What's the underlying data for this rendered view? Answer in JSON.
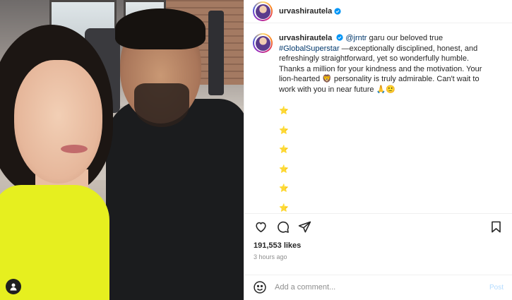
{
  "photo": {
    "user_tag_icon": "person-icon"
  },
  "header": {
    "username": "urvashirautela",
    "verified_icon": "verified-badge-icon",
    "more_icon": "more-horizontal-icon"
  },
  "caption": {
    "username": "urvashirautela",
    "mention": "@jrntr",
    "text_part1": " garu our beloved true ",
    "hashtag": "#GlobalSuperstar",
    "text_part2": " —exceptionally disciplined, honest, and refreshingly straightforward, yet so wonderfully humble. Thanks a million for your kindness and the motivation. Your lion-hearted 🦁 personality is truly admirable. Can't wait to work with you in near future 🙏🙂",
    "stars": [
      "⭐",
      "⭐",
      "⭐",
      "⭐",
      "⭐",
      "⭐"
    ]
  },
  "actions": {
    "like_icon": "heart-icon",
    "comment_icon": "comment-icon",
    "share_icon": "share-icon",
    "save_icon": "bookmark-icon"
  },
  "likes": "191,553 likes",
  "timestamp": "3 hours ago",
  "comment_box": {
    "emoji_icon": "emoji-icon",
    "placeholder": "Add a comment...",
    "post_label": "Post"
  },
  "colors": {
    "link": "#00376b",
    "verified": "#0095f6",
    "post_disabled": "#b3dbff",
    "muted": "#8e8e8e"
  }
}
